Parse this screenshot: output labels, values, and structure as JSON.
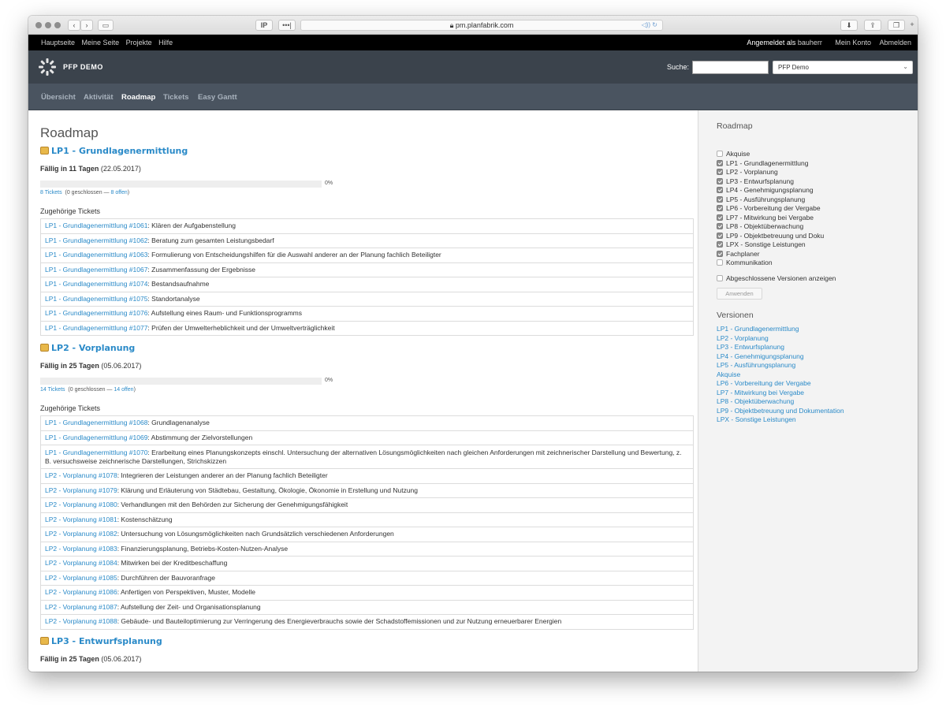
{
  "browser": {
    "url": "pm.planfabrik.com",
    "ip_label": "IP",
    "dots_label": "•••|"
  },
  "topmenu": {
    "links": [
      "Hauptseite",
      "Meine Seite",
      "Projekte",
      "Hilfe"
    ],
    "logged_in_prefix": "Angemeldet als",
    "user": "bauherr",
    "my_account": "Mein Konto",
    "logout": "Abmelden"
  },
  "header": {
    "project_name": "PFP DEMO",
    "search_label": "Suche:",
    "search_value": "",
    "project_select": "PFP Demo"
  },
  "mainnav": {
    "tabs": [
      {
        "label": "Übersicht"
      },
      {
        "label": "Aktivität"
      },
      {
        "label": "Roadmap"
      },
      {
        "label": "Tickets"
      },
      {
        "label": "Easy Gantt"
      }
    ]
  },
  "page": {
    "title": "Roadmap",
    "related_label": "Zugehörige Tickets"
  },
  "versions": [
    {
      "title": "LP1 - Grundlagenermittlung",
      "due_bold": "Fällig in 11 Tagen",
      "due_date": "(22.05.2017)",
      "progress": 0,
      "pct_label": "0%",
      "tickets_link": "8 Tickets",
      "tickets_mid": "(0 geschlossen —",
      "tickets_open": "8 offen",
      "tickets_end": ")",
      "tickets": [
        {
          "ref": "LP1 - Grundlagenermittlung #1061",
          "text": ": Klären der Aufgabenstellung"
        },
        {
          "ref": "LP1 - Grundlagenermittlung #1062",
          "text": ": Beratung zum gesamten Leistungsbedarf"
        },
        {
          "ref": "LP1 - Grundlagenermittlung #1063",
          "text": ": Formulierung von Entscheidungshilfen für die Auswahl anderer an der Planung fachlich Beteiligter"
        },
        {
          "ref": "LP1 - Grundlagenermittlung #1067",
          "text": ": Zusammenfassung der Ergebnisse"
        },
        {
          "ref": "LP1 - Grundlagenermittlung #1074",
          "text": ": Bestandsaufnahme"
        },
        {
          "ref": "LP1 - Grundlagenermittlung #1075",
          "text": ": Standortanalyse"
        },
        {
          "ref": "LP1 - Grundlagenermittlung #1076",
          "text": ": Aufstellung eines Raum- und Funktionsprogramms"
        },
        {
          "ref": "LP1 - Grundlagenermittlung #1077",
          "text": ": Prüfen der Umwelterheblichkeit und der Umweltverträglichkeit"
        }
      ]
    },
    {
      "title": "LP2 - Vorplanung",
      "due_bold": "Fällig in 25 Tagen",
      "due_date": "(05.06.2017)",
      "progress": 0,
      "pct_label": "0%",
      "tickets_link": "14 Tickets",
      "tickets_mid": "(0 geschlossen —",
      "tickets_open": "14 offen",
      "tickets_end": ")",
      "tickets": [
        {
          "ref": "LP1 - Grundlagenermittlung #1068",
          "text": ": Grundlagenanalyse"
        },
        {
          "ref": "LP1 - Grundlagenermittlung #1069",
          "text": ": Abstimmung der Zielvorstellungen"
        },
        {
          "ref": "LP1 - Grundlagenermittlung #1070",
          "text": ": Erarbeitung eines Planungskonzepts einschl. Untersuchung der alternativen Lösungsmöglichkeiten nach gleichen Anforderungen mit zeichnerischer Darstellung und Bewertung, z. B. versuchsweise zeichnerische Darstellungen, Strichskizzen"
        },
        {
          "ref": "LP2 - Vorplanung #1078",
          "text": ": Integrieren der Leistungen anderer an der Planung fachlich Beteiligter"
        },
        {
          "ref": "LP2 - Vorplanung #1079",
          "text": ": Klärung und Erläuterung von Städtebau, Gestaltung, Ökologie, Ökonomie in Erstellung und Nutzung"
        },
        {
          "ref": "LP2 - Vorplanung #1080",
          "text": ": Verhandlungen mit den Behörden zur Sicherung der Genehmigungsfähigkeit"
        },
        {
          "ref": "LP2 - Vorplanung #1081",
          "text": ": Kostenschätzung"
        },
        {
          "ref": "LP2 - Vorplanung #1082",
          "text": ": Untersuchung von Lösungsmöglichkeiten nach Grundsätzlich verschiedenen Anforderungen"
        },
        {
          "ref": "LP2 - Vorplanung #1083",
          "text": ": Finanzierungsplanung, Betriebs-Kosten-Nutzen-Analyse"
        },
        {
          "ref": "LP2 - Vorplanung #1084",
          "text": ": Mitwirken bei der Kreditbeschaffung"
        },
        {
          "ref": "LP2 - Vorplanung #1085",
          "text": ": Durchführen der Bauvoranfrage"
        },
        {
          "ref": "LP2 - Vorplanung #1086",
          "text": ": Anfertigen von Perspektiven, Muster, Modelle"
        },
        {
          "ref": "LP2 - Vorplanung #1087",
          "text": ": Aufstellung der Zeit- und Organisationsplanung"
        },
        {
          "ref": "LP2 - Vorplanung #1088",
          "text": ": Gebäude- und Bauteiloptimierung zur Verringerung des Energieverbrauchs sowie der Schadstoffemissionen und zur Nutzung erneuerbarer Energien"
        }
      ]
    },
    {
      "title": "LP3 - Entwurfsplanung",
      "due_bold": "Fällig in 25 Tagen",
      "due_date": "(05.06.2017)"
    }
  ],
  "sidebar": {
    "roadmap_heading": "Roadmap",
    "trackers": [
      {
        "label": "Akquise",
        "checked": false
      },
      {
        "label": "LP1 - Grundlagenermittlung",
        "checked": true
      },
      {
        "label": "LP2 - Vorplanung",
        "checked": true
      },
      {
        "label": "LP3 - Entwurfsplanung",
        "checked": true
      },
      {
        "label": "LP4 - Genehmigungsplanung",
        "checked": true
      },
      {
        "label": "LP5 - Ausführungsplanung",
        "checked": true
      },
      {
        "label": "LP6 - Vorbereitung der Vergabe",
        "checked": true
      },
      {
        "label": "LP7 - Mitwirkung bei Vergabe",
        "checked": true
      },
      {
        "label": "LP8 - Objektüberwachung",
        "checked": true
      },
      {
        "label": "LP9 - Objektbetreuung und Doku",
        "checked": true
      },
      {
        "label": "LPX - Sonstige Leistungen",
        "checked": true
      },
      {
        "label": "Fachplaner",
        "checked": true
      },
      {
        "label": "Kommunikation",
        "checked": false
      }
    ],
    "show_closed_label": "Abgeschlossene Versionen anzeigen",
    "apply_label": "Anwenden",
    "versions_heading": "Versionen",
    "versions": [
      "LP1 - Grundlagenermittlung",
      "LP2 - Vorplanung",
      "LP3 - Entwurfsplanung",
      "LP4 - Genehmigungsplanung",
      "LP5 - Ausführungsplanung",
      "Akquise",
      "LP6 - Vorbereitung der Vergabe",
      "LP7 - Mitwirkung bei Vergabe",
      "LP8 - Objektüberwachung",
      "LP9 - Objektbetreuung und Dokumentation",
      "LPX - Sonstige Leistungen"
    ]
  }
}
